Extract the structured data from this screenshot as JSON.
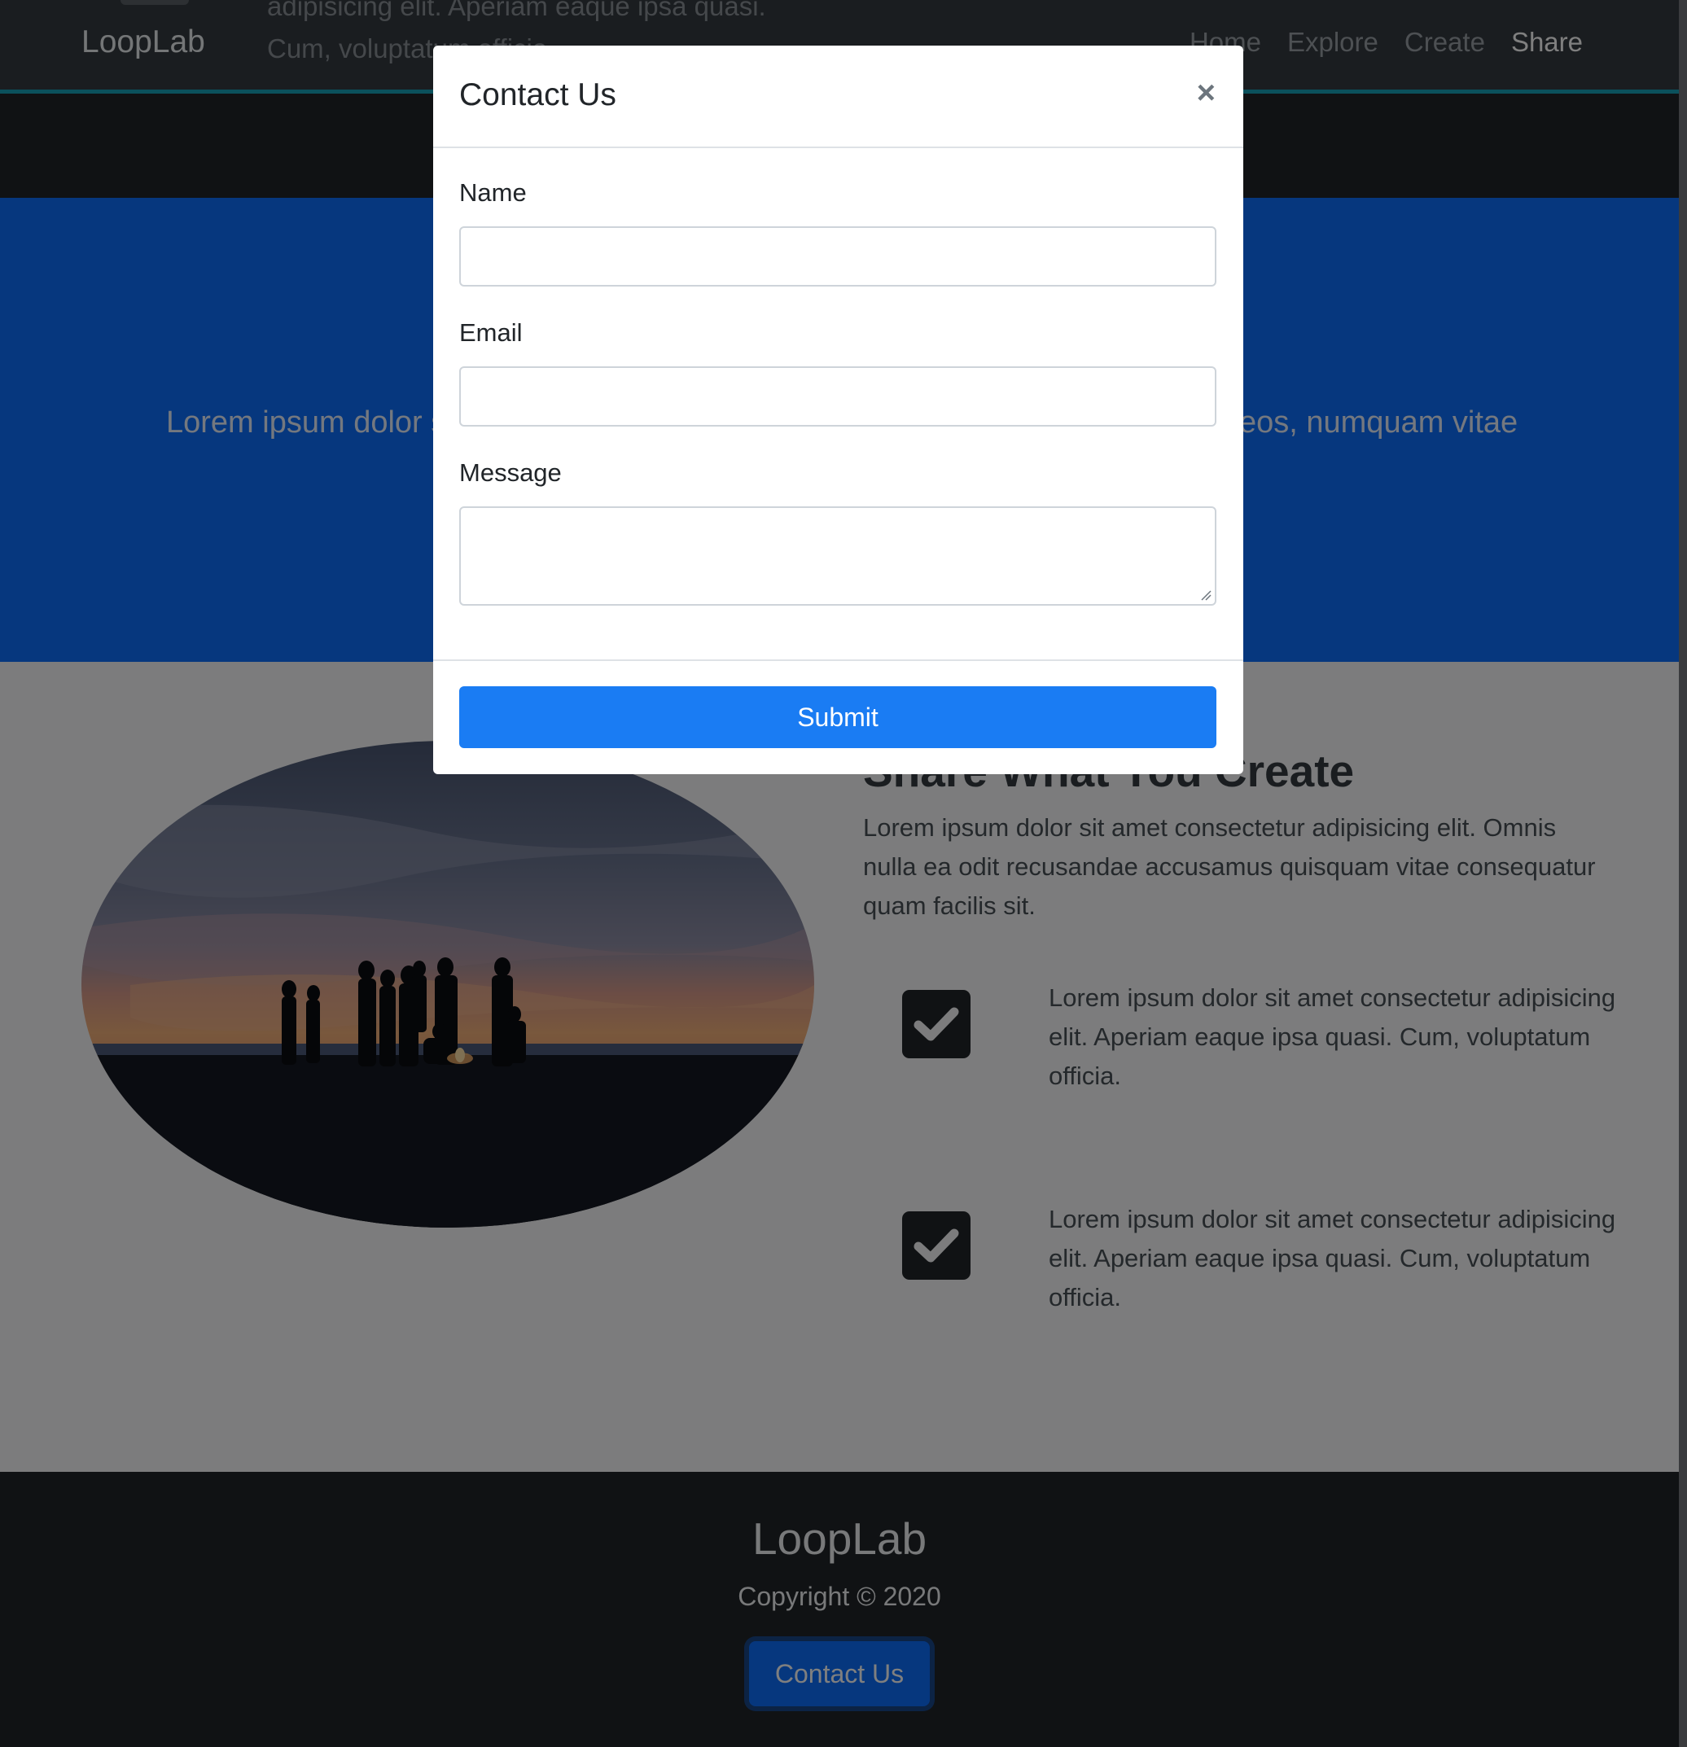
{
  "navbar": {
    "brand": "LoopLab",
    "ghost_text_line1": "adipisicing elit. Aperiam eaque ipsa quasi.",
    "ghost_text_line2": "Cum, voluptatum officia.",
    "links": [
      "Home",
      "Explore",
      "Create",
      "Share"
    ],
    "active_link": "Share"
  },
  "hero": {
    "text_left": "Lorem ipsum dolor s",
    "text_right": "eos, numquam vitae"
  },
  "feature": {
    "image_label": "silhouette-group-at-sunset-photo",
    "title": "Share What You Create",
    "body": "Lorem ipsum dolor sit amet consectetur adipisicing elit. Omnis nulla ea odit recusandae accusamus quisquam vitae consequatur quam facilis sit.",
    "items": [
      {
        "icon": "check-square-icon",
        "text": "Lorem ipsum dolor sit amet consectetur adipisicing elit. Aperiam eaque ipsa quasi. Cum, voluptatum officia."
      },
      {
        "icon": "check-square-icon",
        "text": "Lorem ipsum dolor sit amet consectetur adipisicing elit. Aperiam eaque ipsa quasi. Cum, voluptatum officia."
      }
    ]
  },
  "footer": {
    "brand": "LoopLab",
    "copyright": "Copyright © 2020",
    "contact_button": "Contact Us"
  },
  "modal": {
    "title": "Contact Us",
    "close_symbol": "×",
    "fields": {
      "name_label": "Name",
      "name_value": "",
      "email_label": "Email",
      "email_value": "",
      "message_label": "Message",
      "message_value": ""
    },
    "submit_label": "Submit"
  },
  "colors": {
    "navbar_bg": "#343a40",
    "navbar_accent": "#17a2b8",
    "hero_bg": "#0d6efd",
    "submit_bg": "#1a7cf3",
    "footer_bg": "#212529"
  }
}
